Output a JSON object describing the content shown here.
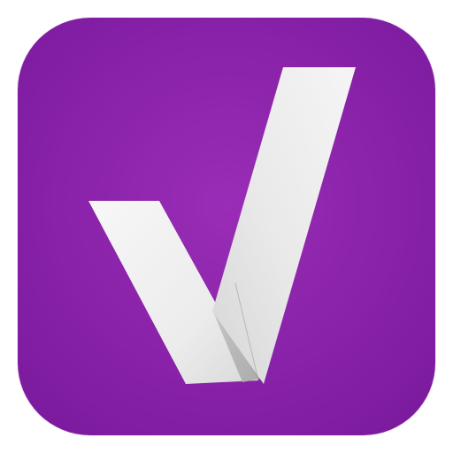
{
  "icon": {
    "name": "checkmark-app-icon",
    "background_center": "#9A2DB6",
    "background_edge": "#7B1A9E",
    "check_light": "#F7F7F7",
    "check_mid": "#E6E6E6",
    "check_shadow": "#BDBDBD",
    "check_shadow_dark": "#A9A9A9"
  }
}
